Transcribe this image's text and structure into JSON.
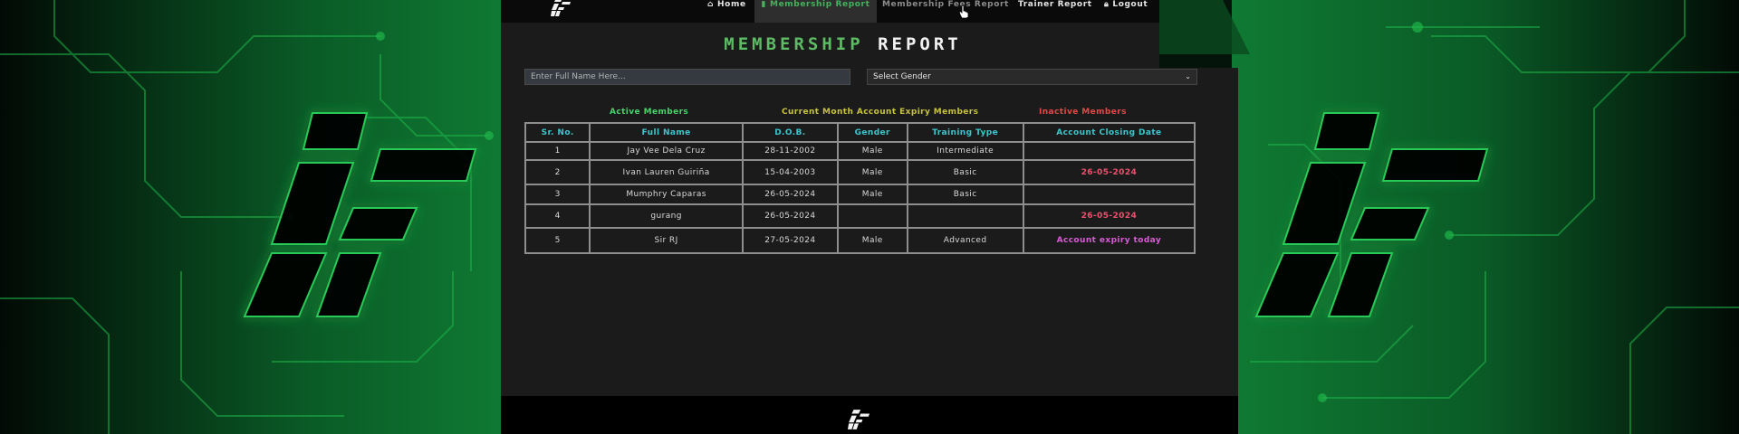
{
  "nav": {
    "home": "Home",
    "membership_report": "Membership Report",
    "membership_fees_report": "Membership Fees Report",
    "trainer_report": "Trainer Report",
    "logout": "Logout"
  },
  "page": {
    "title_part1": "MEMBERSHIP",
    "title_part2": "REPORT"
  },
  "filters": {
    "search_placeholder": "Enter Full Name Here...",
    "gender_value": "Select Gender"
  },
  "legend": {
    "active": "Active Members",
    "expiry": "Current Month Account Expiry Members",
    "inactive": "Inactive Members"
  },
  "table": {
    "headers": [
      "Sr. No.",
      "Full Name",
      "D.O.B.",
      "Gender",
      "Training Type",
      "Account Closing Date"
    ],
    "rows": [
      {
        "sr": "1",
        "name": "Jay Vee Dela Cruz",
        "dob": "28-11-2002",
        "gender": "Male",
        "training": "Intermediate",
        "closing": "",
        "status": "active"
      },
      {
        "sr": "2",
        "name": "Ivan Lauren Guiriña",
        "dob": "15-04-2003",
        "gender": "Male",
        "training": "Basic",
        "closing": "26-05-2024",
        "status": "inactive"
      },
      {
        "sr": "3",
        "name": "Mumphry Caparas",
        "dob": "26-05-2024",
        "gender": "Male",
        "training": "Basic",
        "closing": "",
        "status": "active"
      },
      {
        "sr": "4",
        "name": "gurang",
        "dob": "26-05-2024",
        "gender": "",
        "training": "",
        "closing": "26-05-2024",
        "status": "inactive"
      },
      {
        "sr": "5",
        "name": "Sir RJ",
        "dob": "27-05-2024",
        "gender": "Male",
        "training": "Advanced",
        "closing": "Account expiry today",
        "status": "expiry"
      }
    ]
  },
  "colors": {
    "accent_green": "#42b45c",
    "header_cyan": "#3cc6cc",
    "inactive_red": "#f0506e",
    "expiry_pink": "#d85bd6",
    "expiry_legend_yellow": "#c7c23d",
    "active_legend_green": "#47d26a"
  },
  "icons": {
    "home": "home-icon",
    "membership": "document-icon",
    "logout": "lock-icon",
    "logo": "ff-logo"
  }
}
